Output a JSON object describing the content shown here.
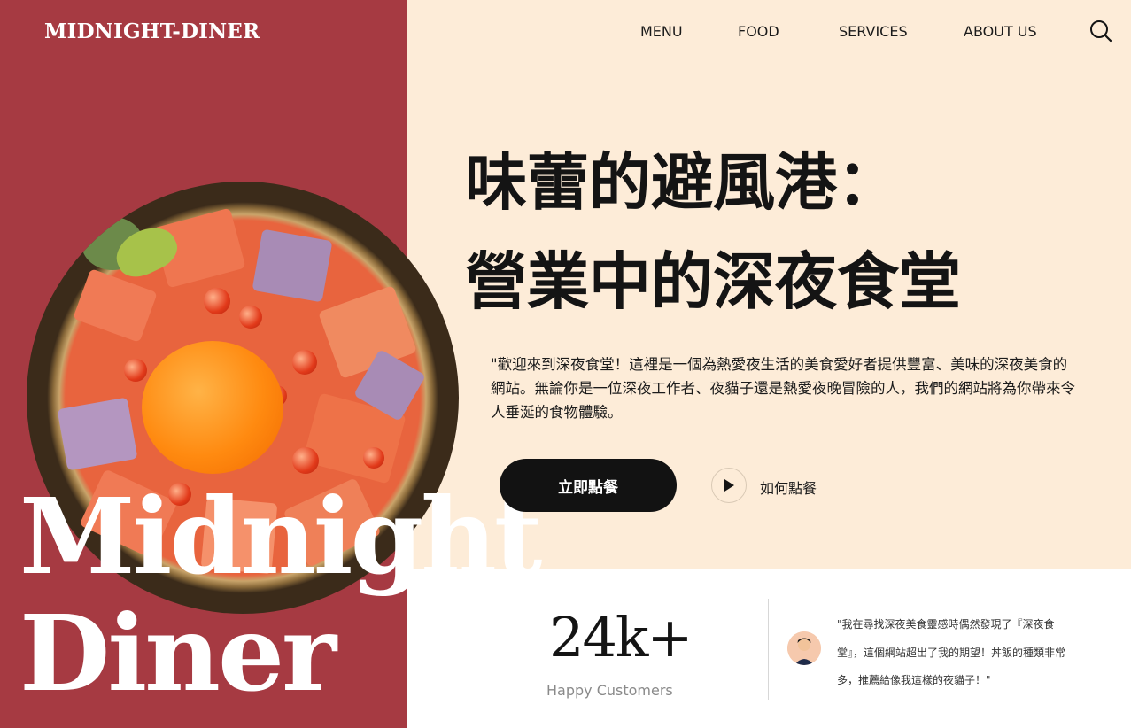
{
  "brand": {
    "logo": "MIDNIGHT-DINER"
  },
  "nav": {
    "items": [
      "MENU",
      "FOOD",
      "SERVICES",
      "ABOUT US"
    ],
    "search_icon": "search-icon"
  },
  "hero": {
    "big_title_line1": "Midnight",
    "big_title_line2": "Diner",
    "headline_line1": "味蕾的避風港：",
    "headline_line2": "營業中的深夜食堂",
    "intro": "\"歡迎來到深夜食堂！這裡是一個為熱愛夜生活的美食愛好者提供豐富、美味的深夜美食的網站。無論你是一位深夜工作者、夜貓子還是熱愛夜晚冒險的人，我們的網站將為你帶來令人垂涎的食物體驗。",
    "order_button": "立即點餐",
    "how_label": "如何點餐",
    "play_icon": "play-icon"
  },
  "stats": {
    "number": "24k+",
    "label": "Happy Customers"
  },
  "testimonial": {
    "quote": "\"我在尋找深夜美食靈感時偶然發現了『深夜食堂』，這個網站超出了我的期望！丼飯的種類非常多，推薦給像我這樣的夜貓子！\"",
    "avatar_icon": "avatar-icon"
  },
  "colors": {
    "accent_red": "#a63a42",
    "cream": "#fdecd8",
    "dark": "#121212"
  }
}
